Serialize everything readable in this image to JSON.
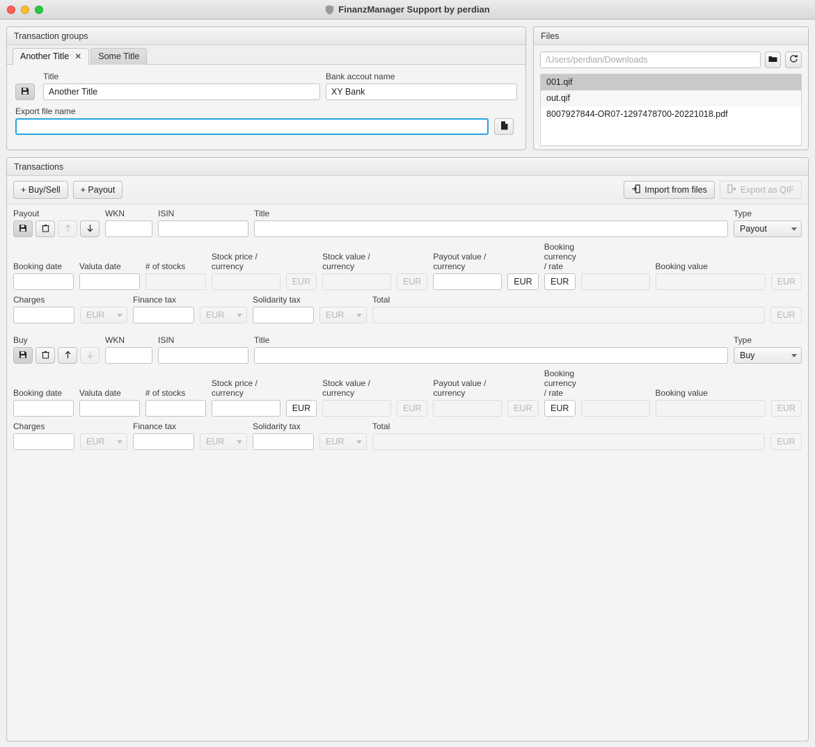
{
  "window": {
    "title": "FinanzManager Support by perdian",
    "icon": "shield-icon"
  },
  "transaction_groups": {
    "panel_title": "Transaction groups",
    "tabs": [
      {
        "label": "Another Title",
        "close": "✕",
        "active": true
      },
      {
        "label": "Some Title",
        "close": "",
        "active": false
      }
    ],
    "save_icon": "floppy-disk-icon",
    "title_label": "Title",
    "title_value": "Another Title",
    "bank_label": "Bank accout name",
    "bank_value": "XY Bank",
    "export_label": "Export file name",
    "export_value": "",
    "export_placeholder": "",
    "export_browse_icon": "document-icon"
  },
  "files": {
    "panel_title": "Files",
    "path_placeholder": "/Users/perdian/Downloads",
    "path_value": "",
    "folder_icon": "folder-icon",
    "refresh_icon": "refresh-icon",
    "entries": [
      {
        "name": "001.qif",
        "selected": true
      },
      {
        "name": "out.qif",
        "selected": false
      },
      {
        "name": "8007927844-OR07-1297478700-20221018.pdf",
        "selected": false
      }
    ]
  },
  "transactions": {
    "panel_title": "Transactions",
    "toolbar": {
      "add_buysell": "+  Buy/Sell",
      "add_payout": "+  Payout",
      "import": "Import from files",
      "import_icon": "import-icon",
      "export": "Export as QIF",
      "export_icon": "export-icon",
      "export_disabled": true
    },
    "labels": {
      "wkn": "WKN",
      "isin": "ISIN",
      "title": "Title",
      "type": "Type",
      "booking_date": "Booking date",
      "valuta_date": "Valuta date",
      "num_stocks": "# of stocks",
      "stock_price": "Stock price / currency",
      "stock_value": "Stock value / currency",
      "payout_value": "Payout value / currency",
      "booking_currency": "Booking currency / rate",
      "booking_value": "Booking value",
      "charges": "Charges",
      "finance_tax": "Finance tax",
      "solidarity_tax": "Solidarity tax",
      "total": "Total"
    },
    "currency": "EUR",
    "entries": [
      {
        "kind_label": "Payout",
        "type_value": "Payout",
        "save_icon": "floppy-disk-icon",
        "delete_icon": "trash-icon",
        "up_icon": "arrow-up-icon",
        "down_icon": "arrow-down-icon",
        "up_disabled": true,
        "down_disabled": false,
        "wkn": "",
        "isin": "",
        "title": "",
        "booking_date": "",
        "valuta_date": "",
        "num_stocks": "",
        "num_stocks_disabled": true,
        "stock_price": "",
        "stock_price_disabled": true,
        "stock_price_cur_disabled": true,
        "stock_value": "",
        "stock_value_disabled": true,
        "stock_value_cur_disabled": true,
        "payout_value": "",
        "payout_value_disabled": false,
        "payout_value_cur_disabled": false,
        "booking_cur": "EUR",
        "booking_cur_disabled": false,
        "booking_rate": "",
        "booking_rate_disabled": true,
        "booking_value": "",
        "booking_value_disabled": true,
        "booking_value_cur_disabled": true,
        "charges": "",
        "charges_cur": "EUR",
        "finance_tax": "",
        "finance_tax_cur": "EUR",
        "solidarity_tax": "",
        "solidarity_tax_cur": "EUR",
        "total": "",
        "total_cur": "EUR"
      },
      {
        "kind_label": "Buy",
        "type_value": "Buy",
        "save_icon": "floppy-disk-icon",
        "delete_icon": "trash-icon",
        "up_icon": "arrow-up-icon",
        "down_icon": "arrow-down-icon",
        "up_disabled": false,
        "down_disabled": true,
        "wkn": "",
        "isin": "",
        "title": "",
        "booking_date": "",
        "valuta_date": "",
        "num_stocks": "",
        "num_stocks_disabled": false,
        "stock_price": "",
        "stock_price_disabled": false,
        "stock_price_cur_disabled": false,
        "stock_value": "",
        "stock_value_disabled": true,
        "stock_value_cur_disabled": true,
        "payout_value": "",
        "payout_value_disabled": true,
        "payout_value_cur_disabled": true,
        "booking_cur": "EUR",
        "booking_cur_disabled": false,
        "booking_rate": "",
        "booking_rate_disabled": true,
        "booking_value": "",
        "booking_value_disabled": true,
        "booking_value_cur_disabled": true,
        "charges": "",
        "charges_cur": "EUR",
        "finance_tax": "",
        "finance_tax_cur": "EUR",
        "solidarity_tax": "",
        "solidarity_tax_cur": "EUR",
        "total": "",
        "total_cur": "EUR"
      }
    ]
  },
  "colors": {
    "focus_ring": "#23a5e0",
    "selection": "#c9c9c9",
    "window_bg": "#f0f0f0"
  }
}
